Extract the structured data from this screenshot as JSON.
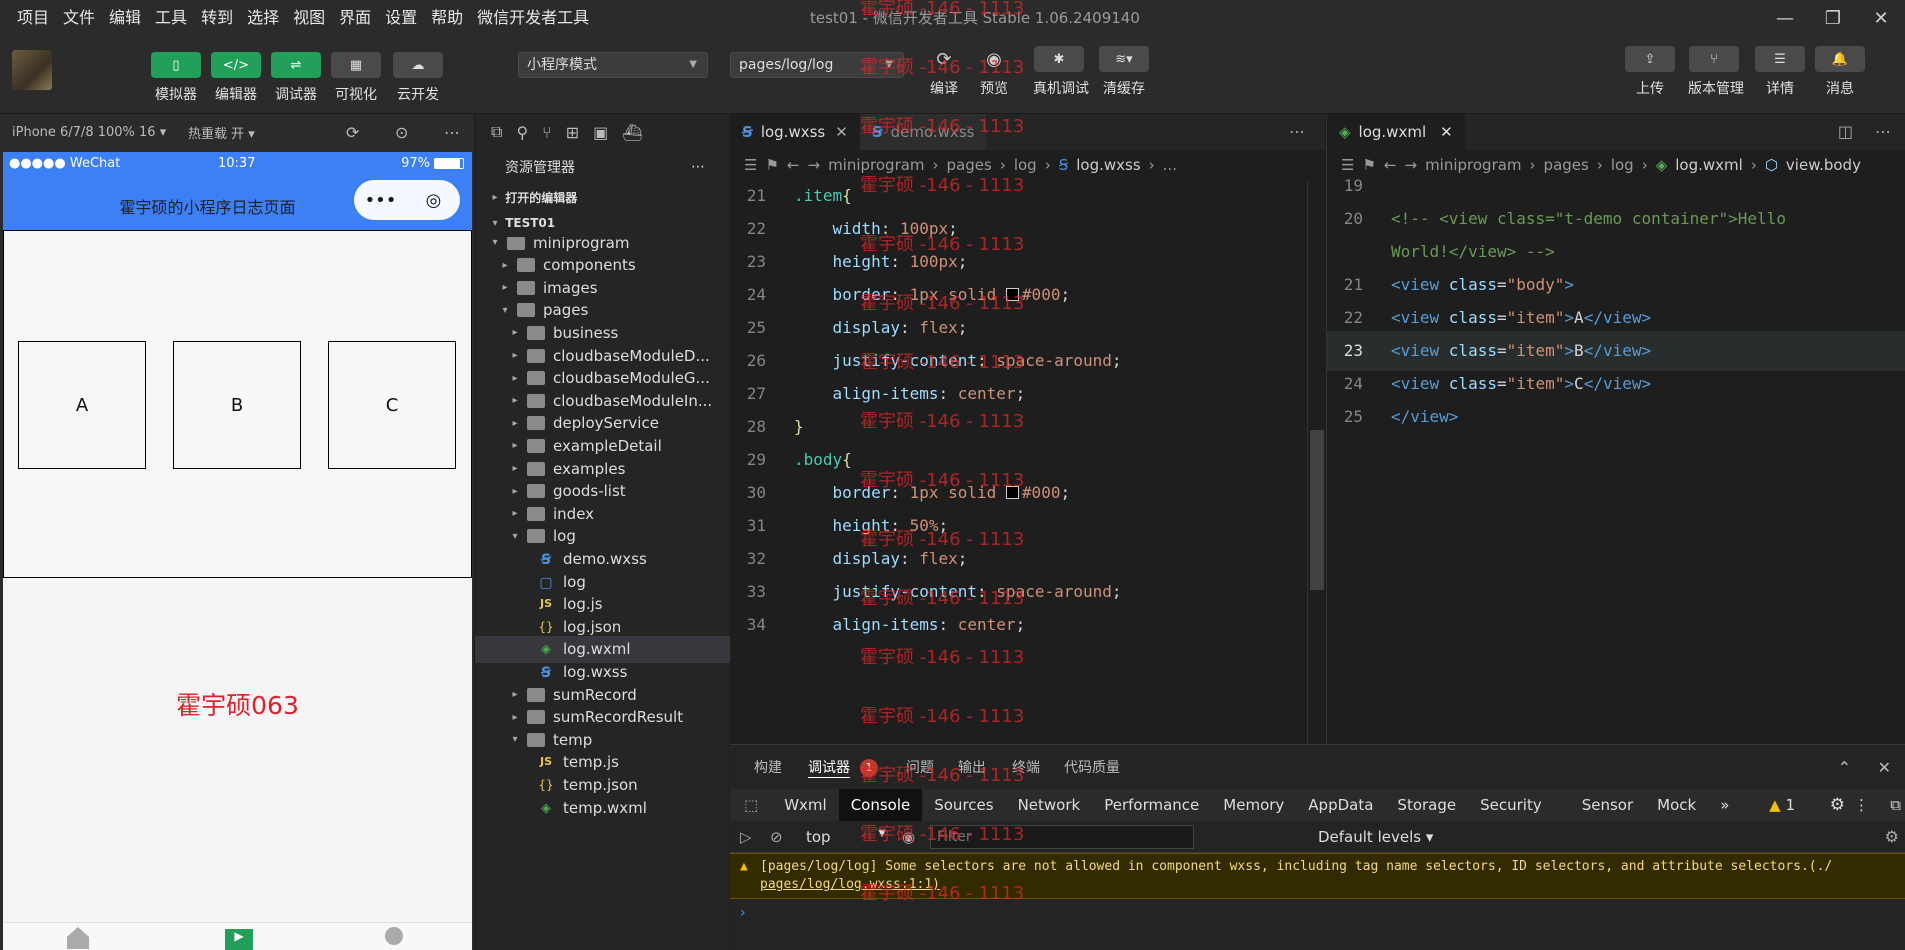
{
  "menu": [
    "项目",
    "文件",
    "编辑",
    "工具",
    "转到",
    "选择",
    "视图",
    "界面",
    "设置",
    "帮助",
    "微信开发者工具"
  ],
  "window_title": "test01 - 微信开发者工具 Stable 1.06.2409140",
  "toolbar": {
    "simulator": "模拟器",
    "editor": "编辑器",
    "debugger": "调试器",
    "visual": "可视化",
    "cloud": "云开发",
    "mode_select": "小程序模式",
    "page_select": "pages/log/log",
    "compile": "编译",
    "preview": "预览",
    "real_debug": "真机调试",
    "clear_cache": "清缓存",
    "upload": "上传",
    "version": "版本管理",
    "details": "详情",
    "messages": "消息"
  },
  "simulator": {
    "device": "iPhone 6/7/8 100% 16 ▾",
    "hot_reload": "热重载 开 ▾",
    "carrier": "●●●●● WeChat",
    "time": "10:37",
    "battery": "97%",
    "nav_title": "霍宇硕的小程序日志页面",
    "items": [
      "A",
      "B",
      "C"
    ],
    "big_text": "霍宇硕063"
  },
  "explorer": {
    "title": "资源管理器",
    "open_editors": "打开的编辑器",
    "project": "TEST01",
    "tree": [
      {
        "label": "miniprogram",
        "depth": 1,
        "type": "folder",
        "twisty": "▾"
      },
      {
        "label": "components",
        "depth": 2,
        "type": "folder",
        "twisty": "▸"
      },
      {
        "label": "images",
        "depth": 2,
        "type": "folder",
        "twisty": "▸"
      },
      {
        "label": "pages",
        "depth": 2,
        "type": "folder",
        "twisty": "▾"
      },
      {
        "label": "business",
        "depth": 3,
        "type": "folder",
        "twisty": "▸"
      },
      {
        "label": "cloudbaseModuleD...",
        "depth": 3,
        "type": "folder",
        "twisty": "▸"
      },
      {
        "label": "cloudbaseModuleG...",
        "depth": 3,
        "type": "folder",
        "twisty": "▸"
      },
      {
        "label": "cloudbaseModuleIn...",
        "depth": 3,
        "type": "folder",
        "twisty": "▸"
      },
      {
        "label": "deployService",
        "depth": 3,
        "type": "folder",
        "twisty": "▸"
      },
      {
        "label": "exampleDetail",
        "depth": 3,
        "type": "folder",
        "twisty": "▸"
      },
      {
        "label": "examples",
        "depth": 3,
        "type": "folder",
        "twisty": "▸"
      },
      {
        "label": "goods-list",
        "depth": 3,
        "type": "folder",
        "twisty": "▸"
      },
      {
        "label": "index",
        "depth": 3,
        "type": "folder",
        "twisty": "▸"
      },
      {
        "label": "log",
        "depth": 3,
        "type": "folder",
        "twisty": "▾"
      },
      {
        "label": "demo.wxss",
        "depth": 4,
        "type": "wxss",
        "twisty": ""
      },
      {
        "label": "log",
        "depth": 4,
        "type": "page",
        "twisty": ""
      },
      {
        "label": "log.js",
        "depth": 4,
        "type": "js",
        "twisty": ""
      },
      {
        "label": "log.json",
        "depth": 4,
        "type": "json",
        "twisty": ""
      },
      {
        "label": "log.wxml",
        "depth": 4,
        "type": "wxml",
        "twisty": "",
        "selected": true
      },
      {
        "label": "log.wxss",
        "depth": 4,
        "type": "wxss",
        "twisty": ""
      },
      {
        "label": "sumRecord",
        "depth": 3,
        "type": "folder",
        "twisty": "▸"
      },
      {
        "label": "sumRecordResult",
        "depth": 3,
        "type": "folder",
        "twisty": "▸"
      },
      {
        "label": "temp",
        "depth": 3,
        "type": "folder",
        "twisty": "▾"
      },
      {
        "label": "temp.js",
        "depth": 4,
        "type": "js",
        "twisty": ""
      },
      {
        "label": "temp.json",
        "depth": 4,
        "type": "json",
        "twisty": ""
      },
      {
        "label": "temp.wxml",
        "depth": 4,
        "type": "wxml",
        "twisty": ""
      }
    ]
  },
  "editor_left": {
    "tabs": [
      "log.wxss",
      "demo.wxss"
    ],
    "breadcrumb": [
      "miniprogram",
      "pages",
      "log",
      "log.wxss",
      "..."
    ],
    "lines": [
      {
        "n": "21",
        "parts": [
          {
            "c": "k-sel",
            "t": ".item"
          },
          {
            "c": "k-yel",
            "t": "{"
          }
        ]
      },
      {
        "n": "22",
        "parts": [
          {
            "c": "k-prop",
            "t": "    width"
          },
          {
            "c": "k-pun",
            "t": ": "
          },
          {
            "c": "k-num",
            "t": "100px"
          },
          {
            "c": "k-pun",
            "t": ";"
          }
        ]
      },
      {
        "n": "23",
        "parts": [
          {
            "c": "k-prop",
            "t": "    height"
          },
          {
            "c": "k-pun",
            "t": ": "
          },
          {
            "c": "k-num",
            "t": "100px"
          },
          {
            "c": "k-pun",
            "t": ";"
          }
        ]
      },
      {
        "n": "24",
        "parts": [
          {
            "c": "k-prop",
            "t": "    border"
          },
          {
            "c": "k-pun",
            "t": ": "
          },
          {
            "c": "k-num",
            "t": "1px solid "
          },
          {
            "c": "swatch",
            "t": ""
          },
          {
            "c": "k-val",
            "t": "#000"
          },
          {
            "c": "k-pun",
            "t": ";"
          }
        ]
      },
      {
        "n": "25",
        "parts": [
          {
            "c": "k-prop",
            "t": "    display"
          },
          {
            "c": "k-pun",
            "t": ": "
          },
          {
            "c": "k-val",
            "t": "flex"
          },
          {
            "c": "k-pun",
            "t": ";"
          }
        ]
      },
      {
        "n": "26",
        "parts": [
          {
            "c": "k-prop",
            "t": "    justify-content"
          },
          {
            "c": "k-pun",
            "t": ": "
          },
          {
            "c": "k-val",
            "t": "space-around"
          },
          {
            "c": "k-pun",
            "t": ";"
          }
        ]
      },
      {
        "n": "27",
        "parts": [
          {
            "c": "k-prop",
            "t": "    align-items"
          },
          {
            "c": "k-pun",
            "t": ": "
          },
          {
            "c": "k-val",
            "t": "center"
          },
          {
            "c": "k-pun",
            "t": ";"
          }
        ]
      },
      {
        "n": "28",
        "parts": [
          {
            "c": "k-yel",
            "t": "}"
          }
        ]
      },
      {
        "n": "29",
        "parts": [
          {
            "c": "k-sel",
            "t": ".body"
          },
          {
            "c": "k-yel",
            "t": "{"
          }
        ]
      },
      {
        "n": "30",
        "parts": [
          {
            "c": "k-prop",
            "t": "    border"
          },
          {
            "c": "k-pun",
            "t": ": "
          },
          {
            "c": "k-num",
            "t": "1px solid "
          },
          {
            "c": "swatch",
            "t": ""
          },
          {
            "c": "k-val",
            "t": "#000"
          },
          {
            "c": "k-pun",
            "t": ";"
          }
        ]
      },
      {
        "n": "31",
        "parts": [
          {
            "c": "k-prop",
            "t": "    height"
          },
          {
            "c": "k-pun",
            "t": ": "
          },
          {
            "c": "k-num",
            "t": "50%"
          },
          {
            "c": "k-pun",
            "t": ";"
          }
        ]
      },
      {
        "n": "32",
        "parts": [
          {
            "c": "k-prop",
            "t": "    display"
          },
          {
            "c": "k-pun",
            "t": ": "
          },
          {
            "c": "k-val",
            "t": "flex"
          },
          {
            "c": "k-pun",
            "t": ";"
          }
        ]
      },
      {
        "n": "33",
        "parts": [
          {
            "c": "k-prop",
            "t": "    justify-content"
          },
          {
            "c": "k-pun",
            "t": ": "
          },
          {
            "c": "k-val",
            "t": "space-around"
          },
          {
            "c": "k-pun",
            "t": ";"
          }
        ]
      },
      {
        "n": "34",
        "parts": [
          {
            "c": "k-prop",
            "t": "    align-items"
          },
          {
            "c": "k-pun",
            "t": ": "
          },
          {
            "c": "k-val",
            "t": "center"
          },
          {
            "c": "k-pun",
            "t": ";"
          }
        ]
      }
    ]
  },
  "editor_right": {
    "tabs": [
      "log.wxml"
    ],
    "breadcrumb": [
      "miniprogram",
      "pages",
      "log",
      "log.wxml",
      "view.body"
    ],
    "lines": [
      {
        "n": "19",
        "parts": []
      },
      {
        "n": "20",
        "parts": [
          {
            "c": "k-com",
            "t": "<!-- <view class=\"t-demo container\">Hello"
          }
        ]
      },
      {
        "n": "",
        "parts": [
          {
            "c": "k-com",
            "t": "World!</view> -->"
          }
        ]
      },
      {
        "n": "21",
        "parts": [
          {
            "c": "k-tag",
            "t": "<view "
          },
          {
            "c": "k-attr",
            "t": "class"
          },
          {
            "c": "k-pun",
            "t": "="
          },
          {
            "c": "k-str",
            "t": "\"body\""
          },
          {
            "c": "k-tag",
            "t": ">"
          }
        ]
      },
      {
        "n": "22",
        "parts": [
          {
            "c": "k-tag",
            "t": "<view "
          },
          {
            "c": "k-attr",
            "t": "class"
          },
          {
            "c": "k-pun",
            "t": "="
          },
          {
            "c": "k-str",
            "t": "\"item\""
          },
          {
            "c": "k-tag",
            "t": ">"
          },
          {
            "c": "k-txt",
            "t": "A"
          },
          {
            "c": "k-tag",
            "t": "</view>"
          }
        ]
      },
      {
        "n": "23",
        "parts": [
          {
            "c": "k-tag",
            "t": "<view "
          },
          {
            "c": "k-attr",
            "t": "class"
          },
          {
            "c": "k-pun",
            "t": "="
          },
          {
            "c": "k-str",
            "t": "\"item\""
          },
          {
            "c": "k-tag",
            "t": ">"
          },
          {
            "c": "k-txt",
            "t": "B"
          },
          {
            "c": "k-tag",
            "t": "</view>"
          }
        ]
      },
      {
        "n": "24",
        "parts": [
          {
            "c": "k-tag",
            "t": "<view "
          },
          {
            "c": "k-attr",
            "t": "class"
          },
          {
            "c": "k-pun",
            "t": "="
          },
          {
            "c": "k-str",
            "t": "\"item\""
          },
          {
            "c": "k-tag",
            "t": ">"
          },
          {
            "c": "k-txt",
            "t": "C"
          },
          {
            "c": "k-tag",
            "t": "</view>"
          }
        ]
      },
      {
        "n": "25",
        "parts": [
          {
            "c": "k-tag",
            "t": "</view>"
          }
        ]
      }
    ]
  },
  "panel": {
    "tabs": [
      "构建",
      "调试器",
      "1",
      "问题",
      "输出",
      "终端",
      "代码质量"
    ],
    "devtools_tabs": [
      "Wxml",
      "Console",
      "Sources",
      "Network",
      "Performance",
      "Memory",
      "AppData",
      "Storage",
      "Security",
      "Sensor",
      "Mock"
    ],
    "context": "top",
    "filter_placeholder": "Filter",
    "levels": "Default levels ▾",
    "warn_count": "1",
    "warning_text": "[pages/log/log] Some selectors are not allowed in component wxss, including tag name selectors, ID selectors, and attribute selectors.(./",
    "warning_link": "pages/log/log.wxss:1:1)",
    "prompt": "›"
  },
  "watermark": "霍宇硕 -146 - 1113",
  "colors": {
    "green": "#22a05a",
    "nav_blue": "#3d7ff5",
    "warn_bg": "#332b00",
    "red_text": "#e0202c"
  }
}
